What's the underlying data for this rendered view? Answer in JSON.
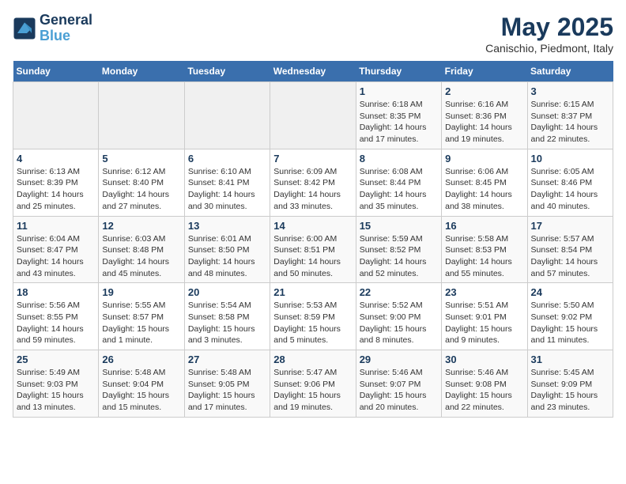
{
  "header": {
    "logo_line1": "General",
    "logo_line2": "Blue",
    "month": "May 2025",
    "location": "Canischio, Piedmont, Italy"
  },
  "weekdays": [
    "Sunday",
    "Monday",
    "Tuesday",
    "Wednesday",
    "Thursday",
    "Friday",
    "Saturday"
  ],
  "weeks": [
    [
      {
        "day": "",
        "info": ""
      },
      {
        "day": "",
        "info": ""
      },
      {
        "day": "",
        "info": ""
      },
      {
        "day": "",
        "info": ""
      },
      {
        "day": "1",
        "info": "Sunrise: 6:18 AM\nSunset: 8:35 PM\nDaylight: 14 hours\nand 17 minutes."
      },
      {
        "day": "2",
        "info": "Sunrise: 6:16 AM\nSunset: 8:36 PM\nDaylight: 14 hours\nand 19 minutes."
      },
      {
        "day": "3",
        "info": "Sunrise: 6:15 AM\nSunset: 8:37 PM\nDaylight: 14 hours\nand 22 minutes."
      }
    ],
    [
      {
        "day": "4",
        "info": "Sunrise: 6:13 AM\nSunset: 8:39 PM\nDaylight: 14 hours\nand 25 minutes."
      },
      {
        "day": "5",
        "info": "Sunrise: 6:12 AM\nSunset: 8:40 PM\nDaylight: 14 hours\nand 27 minutes."
      },
      {
        "day": "6",
        "info": "Sunrise: 6:10 AM\nSunset: 8:41 PM\nDaylight: 14 hours\nand 30 minutes."
      },
      {
        "day": "7",
        "info": "Sunrise: 6:09 AM\nSunset: 8:42 PM\nDaylight: 14 hours\nand 33 minutes."
      },
      {
        "day": "8",
        "info": "Sunrise: 6:08 AM\nSunset: 8:44 PM\nDaylight: 14 hours\nand 35 minutes."
      },
      {
        "day": "9",
        "info": "Sunrise: 6:06 AM\nSunset: 8:45 PM\nDaylight: 14 hours\nand 38 minutes."
      },
      {
        "day": "10",
        "info": "Sunrise: 6:05 AM\nSunset: 8:46 PM\nDaylight: 14 hours\nand 40 minutes."
      }
    ],
    [
      {
        "day": "11",
        "info": "Sunrise: 6:04 AM\nSunset: 8:47 PM\nDaylight: 14 hours\nand 43 minutes."
      },
      {
        "day": "12",
        "info": "Sunrise: 6:03 AM\nSunset: 8:48 PM\nDaylight: 14 hours\nand 45 minutes."
      },
      {
        "day": "13",
        "info": "Sunrise: 6:01 AM\nSunset: 8:50 PM\nDaylight: 14 hours\nand 48 minutes."
      },
      {
        "day": "14",
        "info": "Sunrise: 6:00 AM\nSunset: 8:51 PM\nDaylight: 14 hours\nand 50 minutes."
      },
      {
        "day": "15",
        "info": "Sunrise: 5:59 AM\nSunset: 8:52 PM\nDaylight: 14 hours\nand 52 minutes."
      },
      {
        "day": "16",
        "info": "Sunrise: 5:58 AM\nSunset: 8:53 PM\nDaylight: 14 hours\nand 55 minutes."
      },
      {
        "day": "17",
        "info": "Sunrise: 5:57 AM\nSunset: 8:54 PM\nDaylight: 14 hours\nand 57 minutes."
      }
    ],
    [
      {
        "day": "18",
        "info": "Sunrise: 5:56 AM\nSunset: 8:55 PM\nDaylight: 14 hours\nand 59 minutes."
      },
      {
        "day": "19",
        "info": "Sunrise: 5:55 AM\nSunset: 8:57 PM\nDaylight: 15 hours\nand 1 minute."
      },
      {
        "day": "20",
        "info": "Sunrise: 5:54 AM\nSunset: 8:58 PM\nDaylight: 15 hours\nand 3 minutes."
      },
      {
        "day": "21",
        "info": "Sunrise: 5:53 AM\nSunset: 8:59 PM\nDaylight: 15 hours\nand 5 minutes."
      },
      {
        "day": "22",
        "info": "Sunrise: 5:52 AM\nSunset: 9:00 PM\nDaylight: 15 hours\nand 8 minutes."
      },
      {
        "day": "23",
        "info": "Sunrise: 5:51 AM\nSunset: 9:01 PM\nDaylight: 15 hours\nand 9 minutes."
      },
      {
        "day": "24",
        "info": "Sunrise: 5:50 AM\nSunset: 9:02 PM\nDaylight: 15 hours\nand 11 minutes."
      }
    ],
    [
      {
        "day": "25",
        "info": "Sunrise: 5:49 AM\nSunset: 9:03 PM\nDaylight: 15 hours\nand 13 minutes."
      },
      {
        "day": "26",
        "info": "Sunrise: 5:48 AM\nSunset: 9:04 PM\nDaylight: 15 hours\nand 15 minutes."
      },
      {
        "day": "27",
        "info": "Sunrise: 5:48 AM\nSunset: 9:05 PM\nDaylight: 15 hours\nand 17 minutes."
      },
      {
        "day": "28",
        "info": "Sunrise: 5:47 AM\nSunset: 9:06 PM\nDaylight: 15 hours\nand 19 minutes."
      },
      {
        "day": "29",
        "info": "Sunrise: 5:46 AM\nSunset: 9:07 PM\nDaylight: 15 hours\nand 20 minutes."
      },
      {
        "day": "30",
        "info": "Sunrise: 5:46 AM\nSunset: 9:08 PM\nDaylight: 15 hours\nand 22 minutes."
      },
      {
        "day": "31",
        "info": "Sunrise: 5:45 AM\nSunset: 9:09 PM\nDaylight: 15 hours\nand 23 minutes."
      }
    ]
  ]
}
